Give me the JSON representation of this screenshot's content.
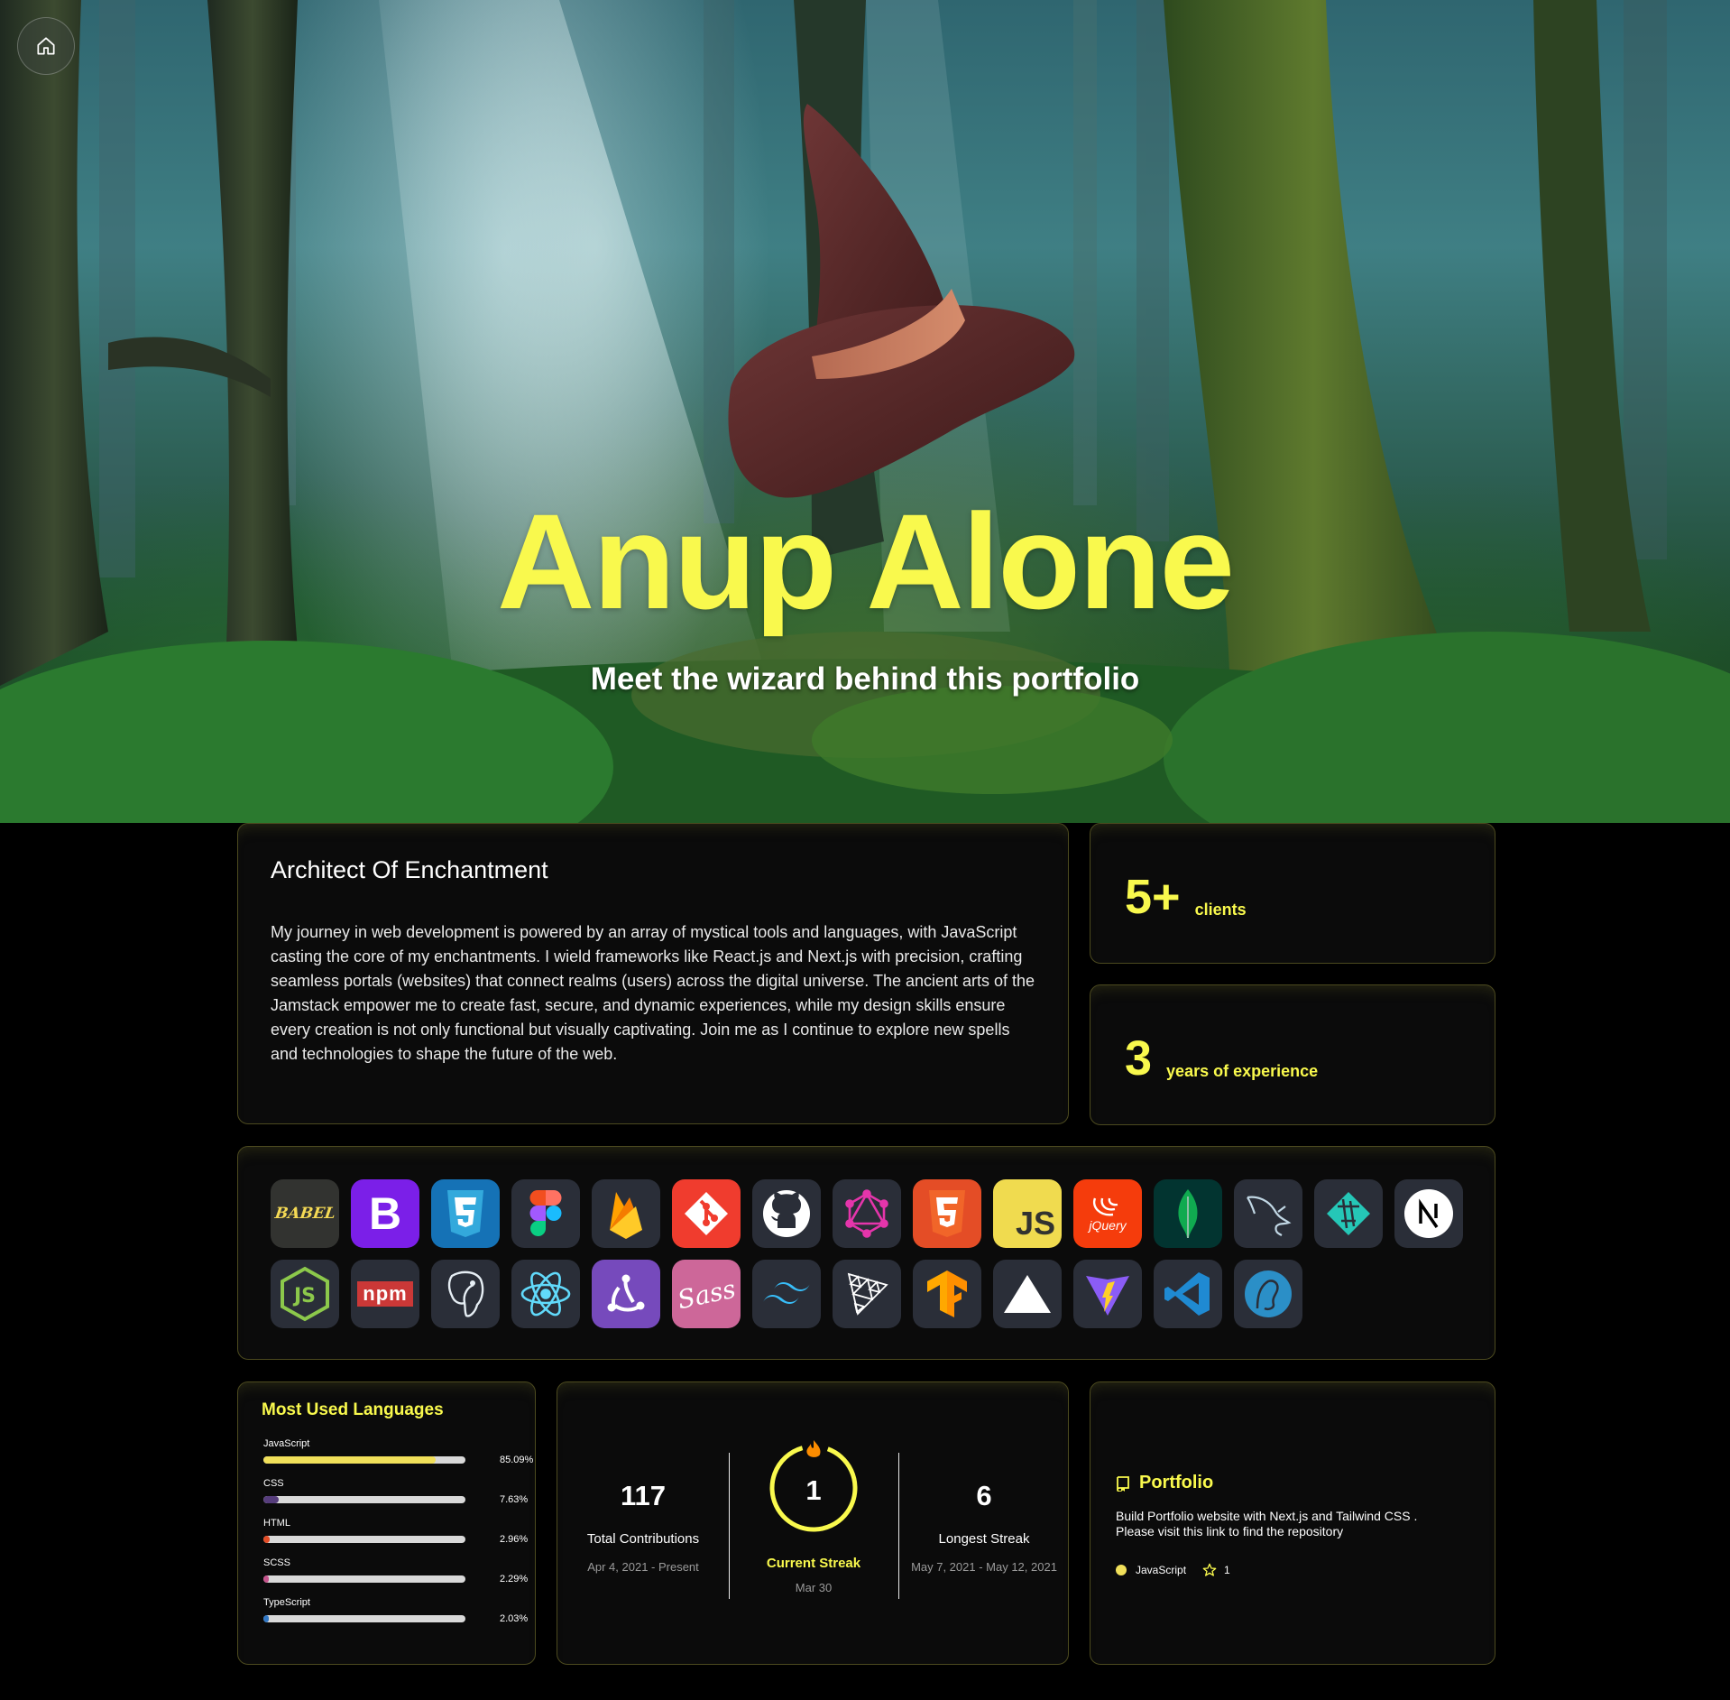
{
  "hero": {
    "title": "Anup Alone",
    "subtitle": "Meet the wizard behind this portfolio",
    "title_color": "#f9f94d",
    "home_icon": "home-icon"
  },
  "about": {
    "heading": "Architect Of Enchantment",
    "body": "My journey in web development is powered by an array of mystical tools and languages, with JavaScript casting the core of my enchantments. I wield frameworks like React.js and Next.js with precision, crafting seamless portals (websites) that connect realms (users) across the digital universe. The ancient arts of the Jamstack empower me to create fast, secure, and dynamic experiences, while my design skills ensure every creation is not only functional but visually captivating. Join me as I continue to explore new spells and technologies to shape the future of the web."
  },
  "stats": [
    {
      "value": "5+",
      "label": "clients"
    },
    {
      "value": "3",
      "label": "years of experience"
    }
  ],
  "skills": [
    "babel-icon",
    "bootstrap-icon",
    "css3-icon",
    "figma-icon",
    "firebase-icon",
    "git-icon",
    "github-icon",
    "graphql-icon",
    "html5-icon",
    "javascript-icon",
    "jquery-icon",
    "mongodb-icon",
    "mysql-icon",
    "netlify-icon",
    "nextjs-icon",
    "nodejs-icon",
    "npm-icon",
    "postgresql-icon",
    "react-icon",
    "redux-icon",
    "sass-icon",
    "tailwind-icon",
    "threejs-icon",
    "tensorflow-icon",
    "vercel-icon",
    "vite-icon",
    "vscode-icon",
    "postcss-icon"
  ],
  "skill_texts": {
    "babel": "BABEL",
    "bootstrap": "B",
    "npm": "npm",
    "jquery": "jQuery",
    "javascript": "JS",
    "sass": "Sass"
  },
  "languages": {
    "heading": "Most Used Languages",
    "items": [
      {
        "name": "JavaScript",
        "percent": 85.09,
        "label": "85.09%",
        "color": "#f1e05a"
      },
      {
        "name": "CSS",
        "percent": 7.63,
        "label": "7.63%",
        "color": "#563d7c"
      },
      {
        "name": "HTML",
        "percent": 2.96,
        "label": "2.96%",
        "color": "#e34c26"
      },
      {
        "name": "SCSS",
        "percent": 2.29,
        "label": "2.29%",
        "color": "#c6538c"
      },
      {
        "name": "TypeScript",
        "percent": 2.03,
        "label": "2.03%",
        "color": "#3178c6"
      }
    ]
  },
  "streak": {
    "total": {
      "value": "117",
      "label": "Total Contributions",
      "range": "Apr 4, 2021 - Present"
    },
    "current": {
      "value": "1",
      "label": "Current Streak",
      "date": "Mar 30"
    },
    "longest": {
      "value": "6",
      "label": "Longest Streak",
      "range": "May 7, 2021 - May 12, 2021"
    },
    "ring_color": "#f9f94d",
    "flame_color": "#fb8c00"
  },
  "repo": {
    "name": "Portfolio",
    "description": "Build Portfolio website with Next.js and Tailwind CSS . Please visit this link to find the repository",
    "language": "JavaScript",
    "language_color": "#f1e05a",
    "stars": "1"
  }
}
